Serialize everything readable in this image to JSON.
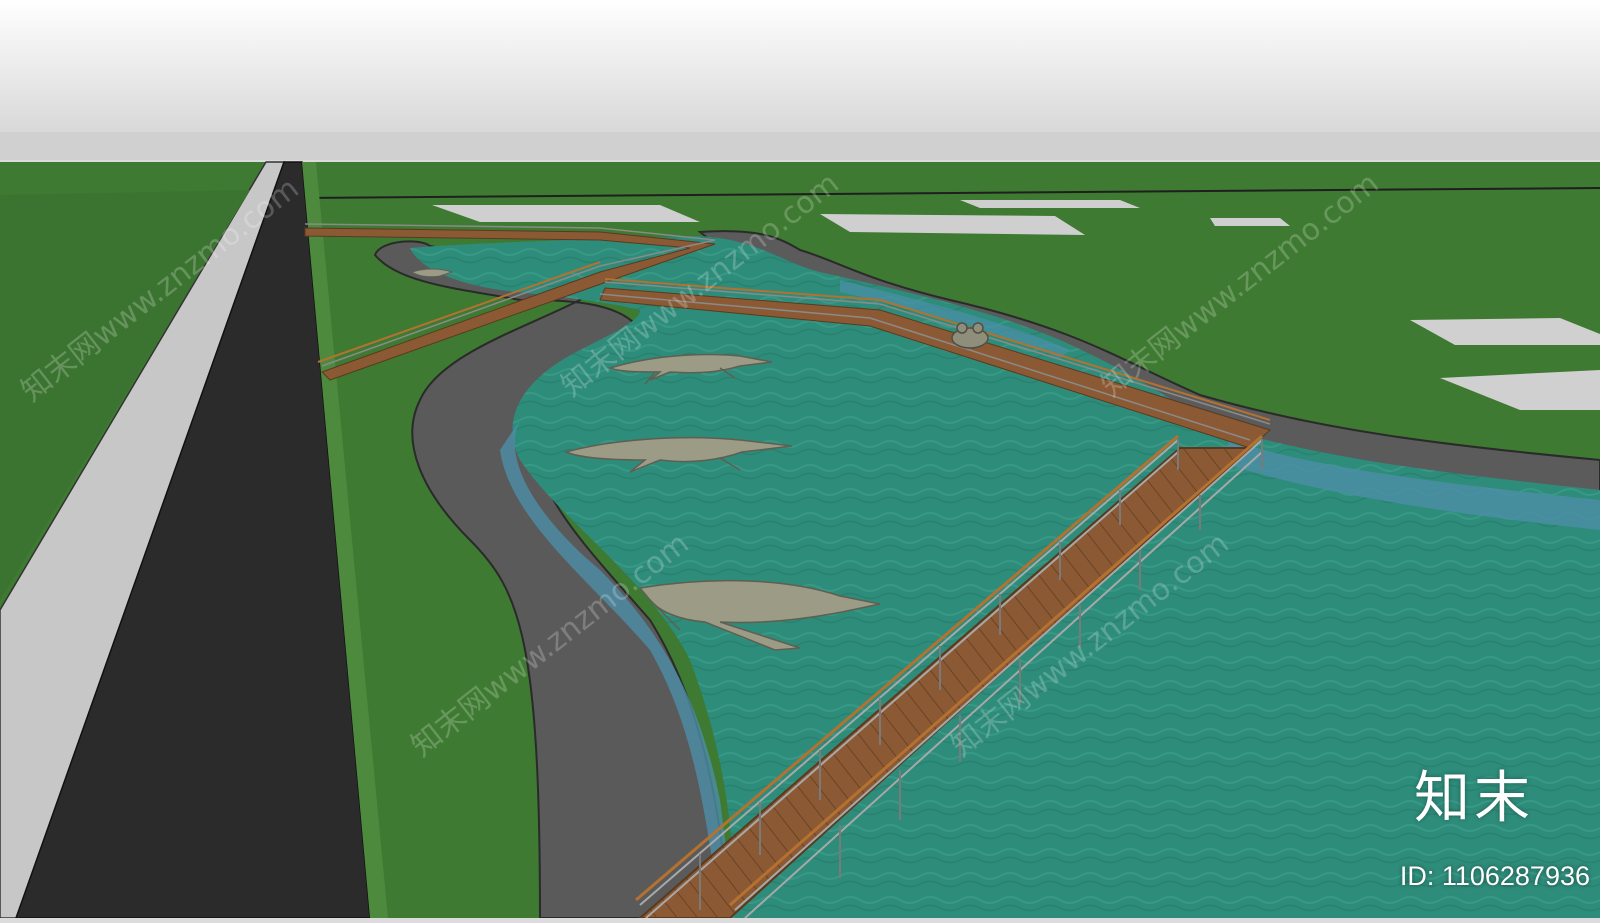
{
  "watermark": {
    "site": "知末网www.znzmo.com",
    "logo": "知末",
    "id_text": "ID: 1106287936"
  },
  "colors": {
    "sky": "#dcdcdc",
    "grass": "#3f7a32",
    "road": "#2b2b2b",
    "path": "#5b5b5b",
    "water": "#2f8f7e",
    "shallow_water": "#4d8fa6",
    "boardwalk": "#8a5a35",
    "railing": "#9a9a9a",
    "crocodile": "#9a9a84"
  }
}
